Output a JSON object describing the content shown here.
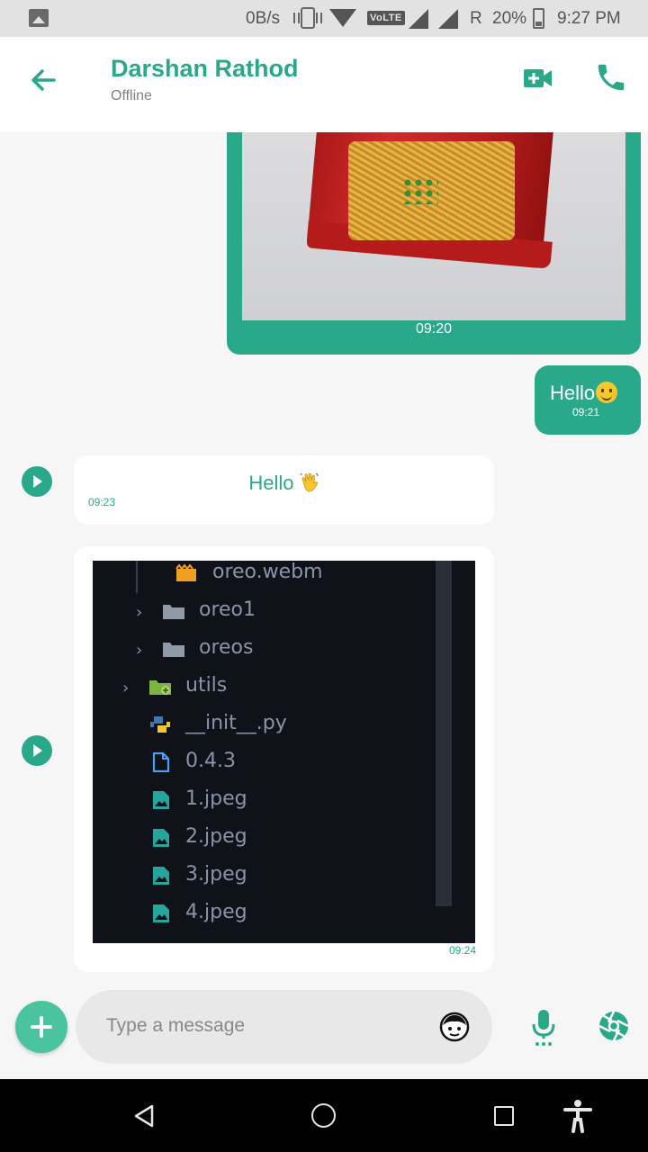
{
  "status_bar": {
    "net_speed": "0B/s",
    "volte": "VoLTE",
    "roaming": "R",
    "battery": "20%",
    "time": "9:27 PM"
  },
  "header": {
    "title": "Darshan Rathod",
    "subtitle": "Offline"
  },
  "messages": [
    {
      "type": "image",
      "direction": "sent",
      "time": "09:20"
    },
    {
      "type": "text",
      "direction": "sent",
      "text": "Hello",
      "emoji": "slightly-smiling-face",
      "time": "09:21"
    },
    {
      "type": "text",
      "direction": "received",
      "text": "Hello",
      "emoji": "waving-hand",
      "time": "09:23"
    },
    {
      "type": "image",
      "direction": "received",
      "time": "09:24",
      "file_tree": [
        {
          "label": "oreo.webm",
          "icon": "video-file-icon"
        },
        {
          "label": "oreo1",
          "icon": "folder-icon"
        },
        {
          "label": "oreos",
          "icon": "folder-icon"
        },
        {
          "label": "utils",
          "icon": "folder-icon"
        },
        {
          "label": "__init__.py",
          "icon": "python-file-icon"
        },
        {
          "label": "0.4.3",
          "icon": "file-icon"
        },
        {
          "label": "1.jpeg",
          "icon": "image-file-icon"
        },
        {
          "label": "2.jpeg",
          "icon": "image-file-icon"
        },
        {
          "label": "3.jpeg",
          "icon": "image-file-icon"
        },
        {
          "label": "4.jpeg",
          "icon": "image-file-icon"
        }
      ]
    }
  ],
  "composer": {
    "placeholder": "Type a message"
  },
  "colors": {
    "accent": "#2aa98a",
    "accent_light": "#4ac49e",
    "background": "#f6f6f6"
  }
}
